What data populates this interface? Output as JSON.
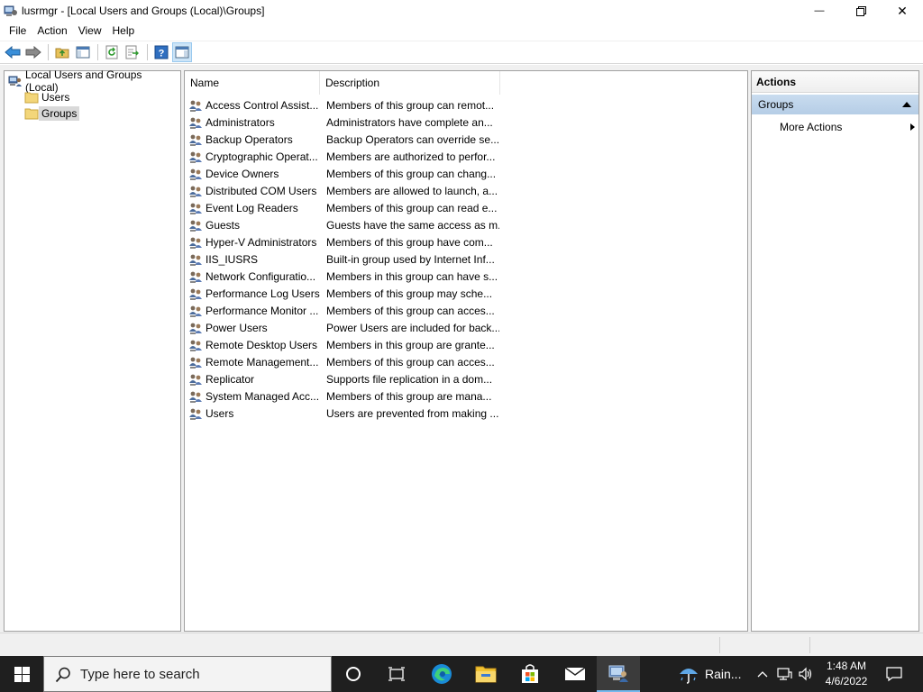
{
  "window": {
    "title": "lusrmgr - [Local Users and Groups (Local)\\Groups]",
    "minimize_symbol": "—",
    "close_symbol": "✕"
  },
  "menu": [
    "File",
    "Action",
    "View",
    "Help"
  ],
  "toolbar": {
    "icons": [
      "back-arrow-icon",
      "forward-arrow-icon",
      "up-folder-icon",
      "show-hide-tree-icon",
      "refresh-icon",
      "export-list-icon",
      "help-icon",
      "show-hide-action-pane-icon"
    ],
    "help_glyph": "?"
  },
  "tree": {
    "root": "Local Users and Groups (Local)",
    "children": [
      "Users",
      "Groups"
    ],
    "selected": "Groups"
  },
  "list": {
    "columns": [
      "Name",
      "Description"
    ],
    "rows": [
      {
        "name": "Access Control Assist...",
        "description": "Members of this group can remot..."
      },
      {
        "name": "Administrators",
        "description": "Administrators have complete an..."
      },
      {
        "name": "Backup Operators",
        "description": "Backup Operators can override se..."
      },
      {
        "name": "Cryptographic Operat...",
        "description": "Members are authorized to perfor..."
      },
      {
        "name": "Device Owners",
        "description": "Members of this group can chang..."
      },
      {
        "name": "Distributed COM Users",
        "description": "Members are allowed to launch, a..."
      },
      {
        "name": "Event Log Readers",
        "description": "Members of this group can read e..."
      },
      {
        "name": "Guests",
        "description": "Guests have the same access as m..."
      },
      {
        "name": "Hyper-V Administrators",
        "description": "Members of this group have com..."
      },
      {
        "name": "IIS_IUSRS",
        "description": "Built-in group used by Internet Inf..."
      },
      {
        "name": "Network Configuratio...",
        "description": "Members in this group can have s..."
      },
      {
        "name": "Performance Log Users",
        "description": "Members of this group may sche..."
      },
      {
        "name": "Performance Monitor ...",
        "description": "Members of this group can acces..."
      },
      {
        "name": "Power Users",
        "description": "Power Users are included for back..."
      },
      {
        "name": "Remote Desktop Users",
        "description": "Members in this group are grante..."
      },
      {
        "name": "Remote Management...",
        "description": "Members of this group can acces..."
      },
      {
        "name": "Replicator",
        "description": "Supports file replication in a dom..."
      },
      {
        "name": "System Managed Acc...",
        "description": "Members of this group are mana..."
      },
      {
        "name": "Users",
        "description": "Users are prevented from making ..."
      }
    ]
  },
  "actions": {
    "title": "Actions",
    "section": "Groups",
    "items": [
      "More Actions"
    ]
  },
  "taskbar": {
    "search_placeholder": "Type here to search",
    "apps": [
      "task-view-icon",
      "edge-icon",
      "file-explorer-icon",
      "store-icon",
      "mail-icon",
      "lusrmgr-icon"
    ],
    "weather": "Rain...",
    "tray_glyphs": {
      "chevron": "^",
      "volume": "🔊"
    },
    "time": "1:48 AM",
    "date": "4/6/2022"
  },
  "colors": {
    "taskbar": "#1f1f1f",
    "actions_section": "#b5cde6",
    "selection": "#d9d9d9"
  }
}
